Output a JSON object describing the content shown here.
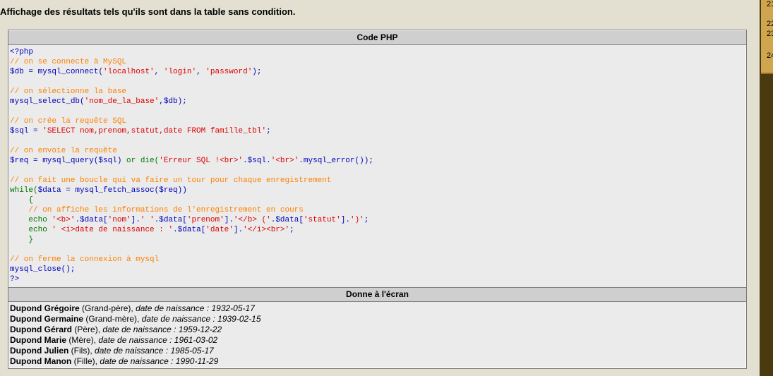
{
  "intro": "Affichage des résultats tels qu'ils sont dans la table sans condition.",
  "code_header": "Code PHP",
  "output_header": "Donne à l'écran",
  "code_lines": [
    [
      {
        "t": "<?php",
        "c": "def"
      }
    ],
    [
      {
        "t": "// on se connecte à MySQL",
        "c": "comment"
      }
    ],
    [
      {
        "t": "$db = mysql_connect(",
        "c": "def"
      },
      {
        "t": "'localhost'",
        "c": "str"
      },
      {
        "t": ", ",
        "c": "def"
      },
      {
        "t": "'login'",
        "c": "str"
      },
      {
        "t": ", ",
        "c": "def"
      },
      {
        "t": "'password'",
        "c": "str"
      },
      {
        "t": ");",
        "c": "def"
      }
    ],
    [],
    [
      {
        "t": "// on sélectionne la base",
        "c": "comment"
      }
    ],
    [
      {
        "t": "mysql_select_db(",
        "c": "def"
      },
      {
        "t": "'nom_de_la_base'",
        "c": "str"
      },
      {
        "t": ",$db);",
        "c": "def"
      }
    ],
    [],
    [
      {
        "t": "// on crée la requête SQL",
        "c": "comment"
      }
    ],
    [
      {
        "t": "$sql = ",
        "c": "def"
      },
      {
        "t": "'SELECT nom,prenom,statut,date FROM famille_tbl'",
        "c": "str"
      },
      {
        "t": ";",
        "c": "def"
      }
    ],
    [],
    [
      {
        "t": "// on envoie la requête",
        "c": "comment"
      }
    ],
    [
      {
        "t": "$req = mysql_query($sql) ",
        "c": "def"
      },
      {
        "t": "or die(",
        "c": "kw"
      },
      {
        "t": "'Erreur SQL !<br>'",
        "c": "str"
      },
      {
        "t": ".$sql.",
        "c": "def"
      },
      {
        "t": "'<br>'",
        "c": "str"
      },
      {
        "t": ".mysql_error());",
        "c": "def"
      }
    ],
    [],
    [
      {
        "t": "// on fait une boucle qui va faire un tour pour chaque enregistrement",
        "c": "comment"
      }
    ],
    [
      {
        "t": "while(",
        "c": "kw"
      },
      {
        "t": "$data = mysql_fetch_assoc($req))",
        "c": "def"
      }
    ],
    [
      {
        "t": "    {",
        "c": "kw"
      }
    ],
    [
      {
        "t": "    // on affiche les informations de l'enregistrement en cours",
        "c": "comment"
      }
    ],
    [
      {
        "t": "    echo ",
        "c": "kw"
      },
      {
        "t": "'<b>'",
        "c": "str"
      },
      {
        "t": ".$data[",
        "c": "def"
      },
      {
        "t": "'nom'",
        "c": "str"
      },
      {
        "t": "].",
        "c": "def"
      },
      {
        "t": "' '",
        "c": "str"
      },
      {
        "t": ".$data[",
        "c": "def"
      },
      {
        "t": "'prenom'",
        "c": "str"
      },
      {
        "t": "].",
        "c": "def"
      },
      {
        "t": "'</b> ('",
        "c": "str"
      },
      {
        "t": ".$data[",
        "c": "def"
      },
      {
        "t": "'statut'",
        "c": "str"
      },
      {
        "t": "].",
        "c": "def"
      },
      {
        "t": "')'",
        "c": "str"
      },
      {
        "t": ";",
        "c": "def"
      }
    ],
    [
      {
        "t": "    echo ",
        "c": "kw"
      },
      {
        "t": "' <i>date de naissance : '",
        "c": "str"
      },
      {
        "t": ".$data[",
        "c": "def"
      },
      {
        "t": "'date'",
        "c": "str"
      },
      {
        "t": "].",
        "c": "def"
      },
      {
        "t": "'</i><br>'",
        "c": "str"
      },
      {
        "t": ";",
        "c": "def"
      }
    ],
    [
      {
        "t": "    }",
        "c": "kw"
      }
    ],
    [],
    [
      {
        "t": "// on ferme la connexion à mysql",
        "c": "comment"
      }
    ],
    [
      {
        "t": "mysql_close();",
        "c": "def"
      }
    ],
    [
      {
        "t": "?>",
        "c": "def"
      }
    ]
  ],
  "results": [
    {
      "name": "Dupond Grégoire",
      "status": "Grand-père",
      "label": "date de naissance :",
      "date": "1932-05-17"
    },
    {
      "name": "Dupond Germaine",
      "status": "Grand-mère",
      "label": "date de naissance :",
      "date": "1939-02-15"
    },
    {
      "name": "Dupond Gérard",
      "status": "Père",
      "label": "date de naissance :",
      "date": "1959-12-22"
    },
    {
      "name": "Dupond Marie",
      "status": "Mère",
      "label": "date de naissance :",
      "date": "1961-03-02"
    },
    {
      "name": "Dupond Julien",
      "status": "Fils",
      "label": "date de naissance :",
      "date": "1985-05-17"
    },
    {
      "name": "Dupond Manon",
      "status": "Fille",
      "label": "date de naissance :",
      "date": "1990-11-29"
    }
  ],
  "side_numbers": [
    "21",
    "22",
    "23",
    "24"
  ],
  "colors": {
    "comment": "#ff8000",
    "string": "#dd0000",
    "keyword": "#007700",
    "default": "#0000bb"
  }
}
